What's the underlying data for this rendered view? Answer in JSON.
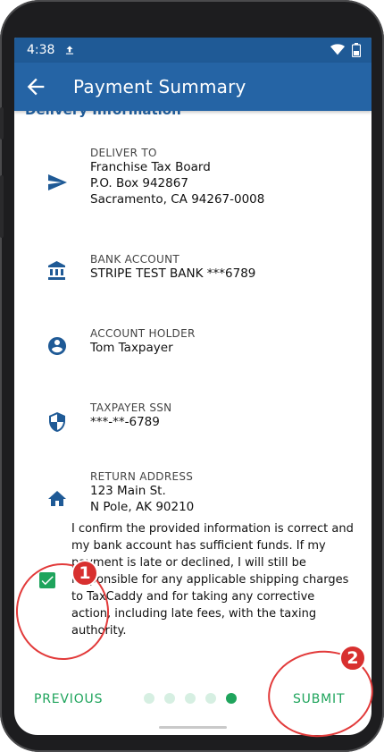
{
  "status_bar": {
    "time": "4:38"
  },
  "app_bar": {
    "title": "Payment Summary"
  },
  "section": {
    "title": "Delivery Information"
  },
  "rows": [
    {
      "icon": "send-icon",
      "label": "DELIVER TO",
      "lines": [
        "Franchise Tax Board",
        "P.O. Box 942867",
        "Sacramento, CA 94267-0008"
      ]
    },
    {
      "icon": "bank-icon",
      "label": "BANK ACCOUNT",
      "lines": [
        "STRIPE TEST BANK ***6789"
      ]
    },
    {
      "icon": "account-circle-icon",
      "label": "ACCOUNT HOLDER",
      "lines": [
        "Tom Taxpayer"
      ]
    },
    {
      "icon": "shield-icon",
      "label": "TAXPAYER SSN",
      "lines": [
        "***-**-6789"
      ]
    },
    {
      "icon": "home-icon",
      "label": "RETURN ADDRESS",
      "lines": [
        "123 Main St.",
        "N Pole, AK 90210"
      ]
    }
  ],
  "confirm": {
    "text": "I confirm the provided information is correct and my bank account has sufficient funds. If my payment is late or declined, I will still be responsible for any applicable shipping charges to TaxCaddy and for taking any corrective action, including late fees, with the taxing authority.",
    "checked": true
  },
  "bottom_bar": {
    "previous_label": "PREVIOUS",
    "submit_label": "SUBMIT",
    "page_count": 5,
    "current_page": 5
  },
  "annotations": {
    "badge_1": "1",
    "badge_2": "2"
  },
  "colors": {
    "appbar": "#2564a5",
    "statusbar": "#1f5a96",
    "accent_green": "#1fa45c",
    "icon_blue": "#1f5a96",
    "annotation_red": "#e23a3a"
  }
}
